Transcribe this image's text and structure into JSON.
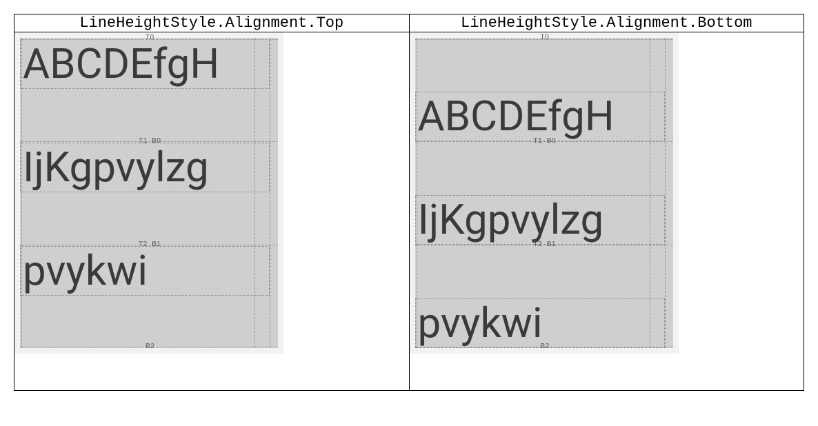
{
  "columns": [
    {
      "header": "LineHeightStyle.Alignment.Top",
      "alignment": "top",
      "lines": [
        {
          "text": "ABCDEfgH",
          "topMarker": "T0",
          "bottomMarker": ""
        },
        {
          "text": "IjKgpvylzg",
          "topMarker": "T1",
          "bottomMarker": "B0"
        },
        {
          "text": "pvykwi",
          "topMarker": "T2",
          "bottomMarker": "B1"
        }
      ],
      "finalBottomMarker": "B2"
    },
    {
      "header": "LineHeightStyle.Alignment.Bottom",
      "alignment": "bottom",
      "lines": [
        {
          "text": "ABCDEfgH",
          "topMarker": "T0",
          "bottomMarker": ""
        },
        {
          "text": "IjKgpvylzg",
          "topMarker": "T1",
          "bottomMarker": "B0"
        },
        {
          "text": "pvykwi",
          "topMarker": "T2",
          "bottomMarker": "B1"
        }
      ],
      "finalBottomMarker": "B2"
    }
  ],
  "diagram": {
    "lineHeightPx": 150,
    "textHeightPx": 72,
    "innerTextBoxWidth": 340,
    "innerTextBoxRightWidth": 360
  }
}
